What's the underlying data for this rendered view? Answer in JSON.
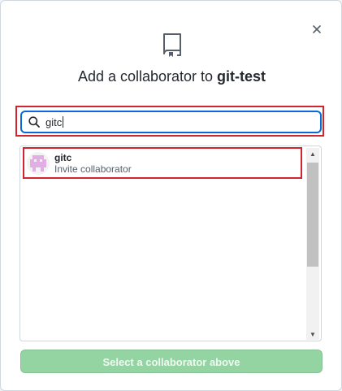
{
  "dialog": {
    "title_prefix": "Add a collaborator to ",
    "repo_name": "git-test",
    "close_icon": "close-icon",
    "repo_icon": "repo-icon"
  },
  "search": {
    "value": "gitc",
    "icon": "search-icon"
  },
  "results": [
    {
      "name": "gitc",
      "subtitle": "Invite collaborator",
      "avatar_colors": [
        "#e1aee5",
        "#f3f3f3"
      ]
    }
  ],
  "submit": {
    "label": "Select a collaborator above",
    "enabled": false
  },
  "colors": {
    "highlight": "#d1242f",
    "focus": "#0969da",
    "button_disabled": "#94d3a2"
  }
}
